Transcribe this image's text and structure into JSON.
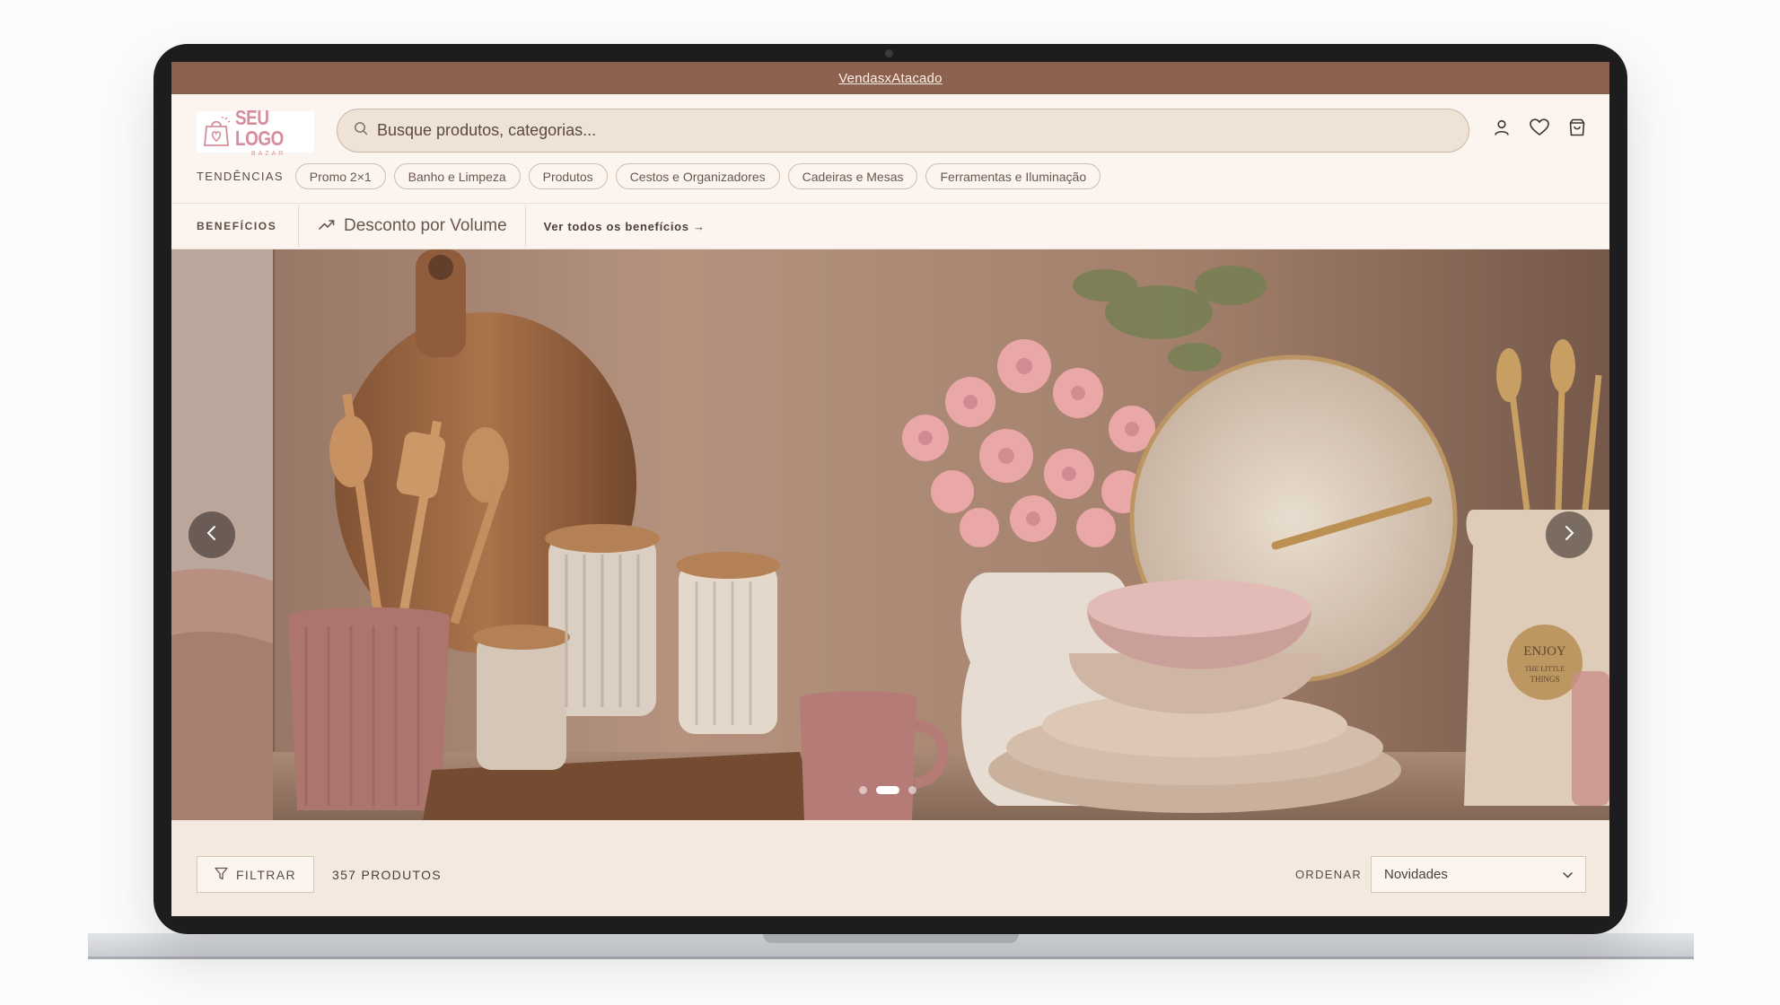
{
  "announcement": {
    "link_text": "VendasxAtacado"
  },
  "header": {
    "logo": {
      "main": "SEU LOGO",
      "sub": "BAZAR"
    },
    "search": {
      "placeholder": "Busque produtos, categorias..."
    },
    "icons": [
      "user-icon",
      "heart-icon",
      "shopping-bag-icon"
    ]
  },
  "trends": {
    "label": "TENDÊNCIAS",
    "chips": [
      "Promo 2×1",
      "Banho e Limpeza",
      "Produtos",
      "Cestos e Organizadores",
      "Cadeiras e Mesas",
      "Ferramentas e Iluminação"
    ]
  },
  "benefits": {
    "label": "BENEFÍCIOS",
    "item": "Desconto por Volume",
    "link": "Ver todos os benefícios →"
  },
  "hero": {
    "slide_count": 3,
    "active_slide": 2,
    "badge_text": "ENJOY THE LITTLE THINGS"
  },
  "toolbar": {
    "filter_label": "FILTRAR",
    "count": "357 PRODUTOS",
    "order_label": "ORDENAR",
    "order_value": "Novidades"
  },
  "colors": {
    "announcement_bg": "#8d6150",
    "header_bg": "#fcf5ef",
    "accent_pink": "#d68d9b",
    "text_dark": "#4c3e36"
  }
}
